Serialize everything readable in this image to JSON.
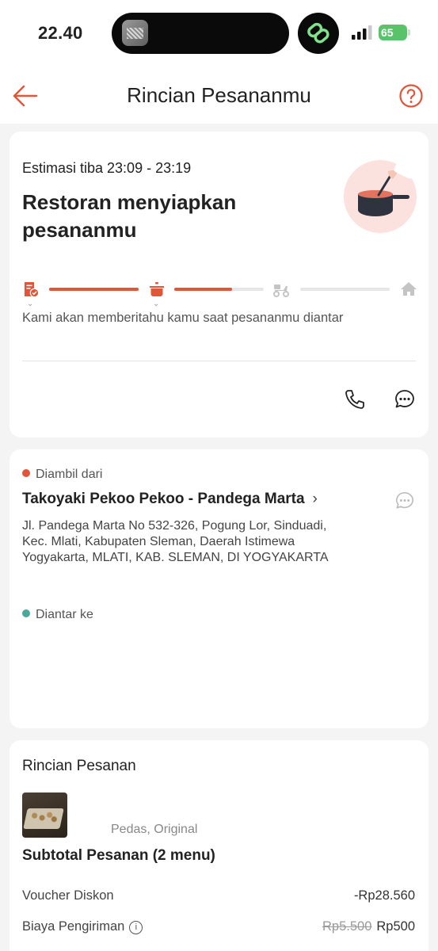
{
  "status_bar": {
    "time": "22.40",
    "battery": "65"
  },
  "header": {
    "title": "Rincian Pesananmu"
  },
  "order_status": {
    "eta": "Estimasi tiba 23:09 - 23:19",
    "title": "Restoran menyiapkan pesananmu",
    "notify_text": "Kami akan memberitahu kamu saat pesananmu diantar",
    "progress": [
      {
        "step": "order-confirmed",
        "icon": "receipt-check-icon",
        "completed_fraction": 1.0
      },
      {
        "step": "preparing",
        "icon": "cooking-pot-icon",
        "completed_fraction": 0.65
      },
      {
        "step": "delivering",
        "icon": "scooter-icon",
        "completed_fraction": 0.0
      },
      {
        "step": "arrived",
        "icon": "home-icon"
      }
    ]
  },
  "pickup": {
    "label": "Diambil dari",
    "restaurant": "Takoyaki Pekoo Pekoo - Pandega Marta",
    "address": "Jl. Pandega Marta No 532-326, Pogung Lor, Sinduadi, Kec. Mlati, Kabupaten Sleman, Daerah Istimewa Yogyakarta, MLATI, KAB. SLEMAN, DI YOGYAKARTA"
  },
  "delivery": {
    "label": "Diantar ke"
  },
  "order_details": {
    "title": "Rincian Pesanan",
    "item_variant": "Pedas, Original",
    "subtotal_label": "Subtotal Pesanan (2 menu)",
    "voucher_label": "Voucher Diskon",
    "voucher_value": "-Rp28.560",
    "shipping_label": "Biaya Pengiriman",
    "shipping_original": "Rp5.500",
    "shipping_value": "Rp500"
  },
  "colors": {
    "accent": "#e1553b",
    "pickup_dot": "#e1553b",
    "delivery_dot": "#4aa89a",
    "track_bg": "#e6e6e6"
  }
}
